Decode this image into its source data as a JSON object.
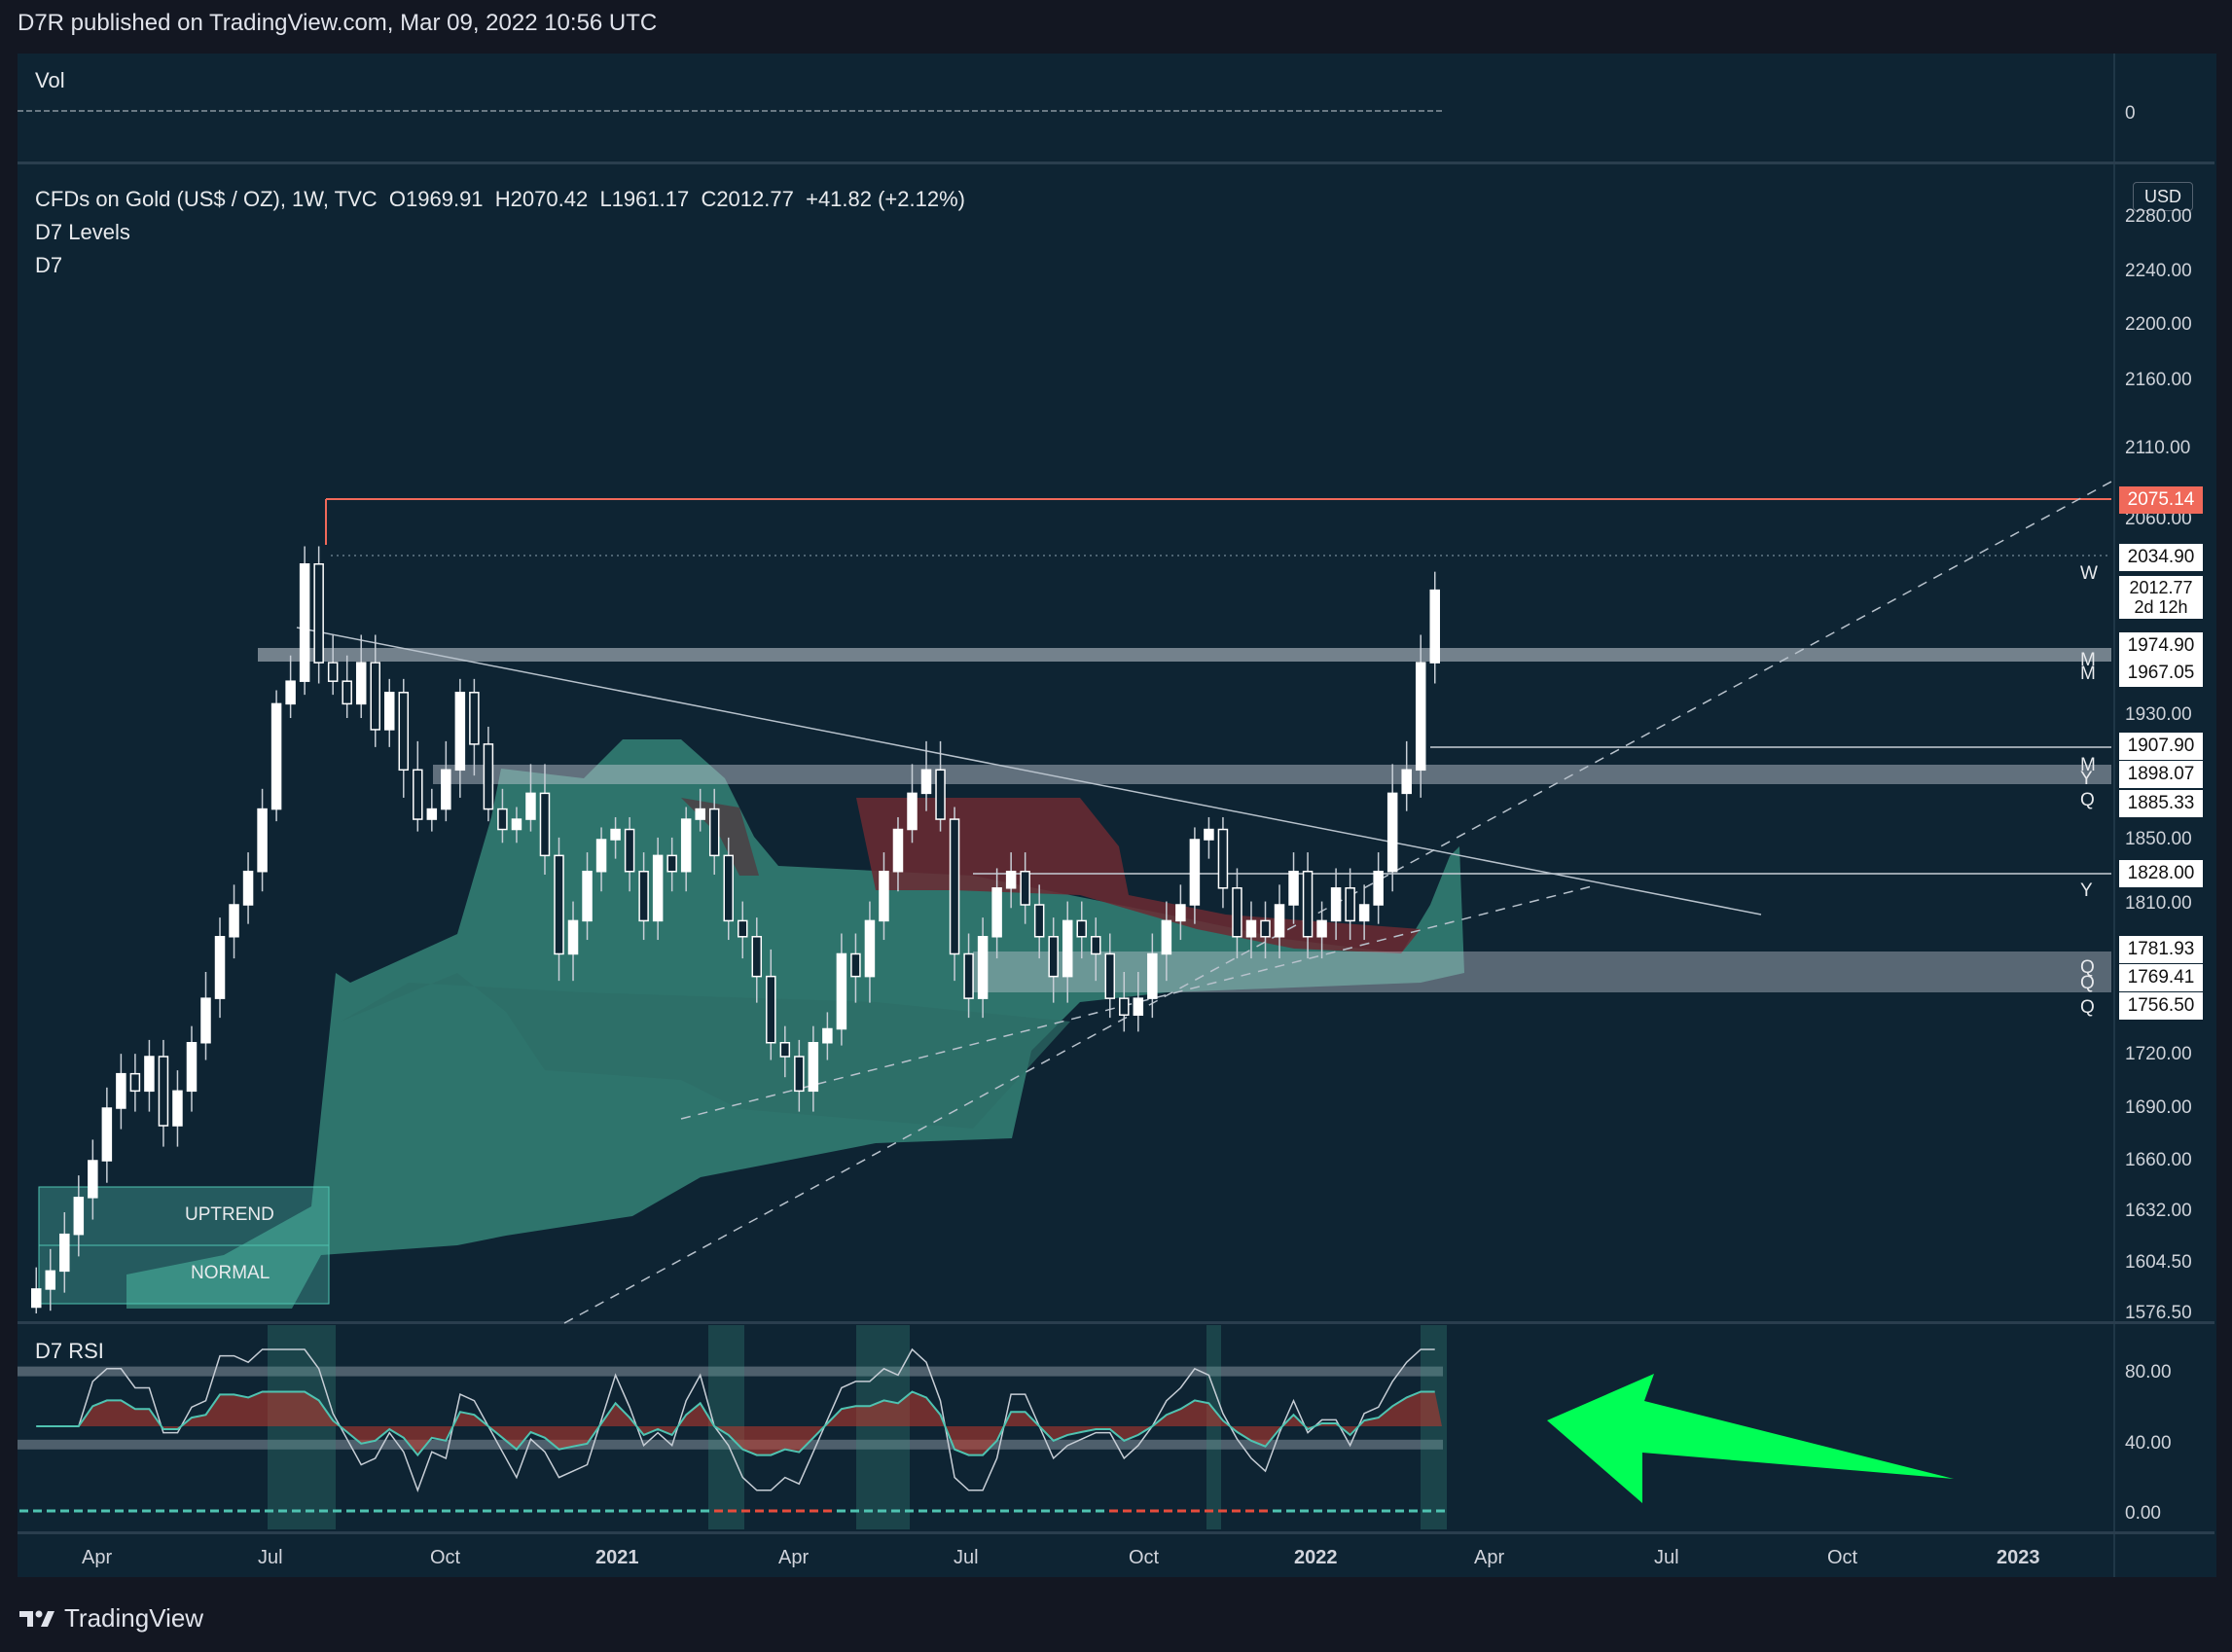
{
  "header": {
    "publisher": "D7R published on TradingView.com, Mar 09, 2022 10:56 UTC"
  },
  "volume_pane": {
    "title": "Vol",
    "axis_value": "0"
  },
  "main_pane": {
    "title": "CFDs on Gold (US$ / OZ), 1W, TVC",
    "ohlc": {
      "open": "O1969.91",
      "high": "H2070.42",
      "low": "L1961.17",
      "close": "C2012.77",
      "change": "+41.82 (+2.12%)"
    },
    "indicators": [
      "D7 Levels",
      "D7"
    ],
    "currency": "USD",
    "box_labels": {
      "upper": "UPTREND",
      "lower": "NORMAL"
    }
  },
  "rsi_pane": {
    "title": "D7 RSI",
    "ticks": [
      "80.00",
      "40.00",
      "0.00"
    ]
  },
  "price_axis": {
    "ticks": [
      "2280.00",
      "2240.00",
      "2200.00",
      "2160.00",
      "2110.00",
      "2060.00",
      "1930.00",
      "1850.00",
      "1810.00",
      "1720.00",
      "1690.00",
      "1660.00",
      "1632.00",
      "1604.50",
      "1576.50"
    ],
    "tags": [
      {
        "value": "2075.14",
        "style": "red"
      },
      {
        "value": "2034.90",
        "style": "white"
      },
      {
        "value": "2012.77",
        "sub": "2d 12h",
        "style": "white"
      },
      {
        "value": "1974.90",
        "style": "white"
      },
      {
        "value": "1967.05",
        "style": "white"
      },
      {
        "value": "1907.90",
        "style": "white"
      },
      {
        "value": "1898.07",
        "style": "white"
      },
      {
        "value": "1885.33",
        "style": "white"
      },
      {
        "value": "1828.00",
        "style": "white"
      },
      {
        "value": "1781.93",
        "style": "white"
      },
      {
        "value": "1769.41",
        "style": "white"
      },
      {
        "value": "1756.50",
        "style": "white"
      }
    ],
    "level_letters": [
      "W",
      "M",
      "M",
      "M",
      "Y",
      "Q",
      "Y",
      "Q",
      "Q",
      "Q"
    ]
  },
  "time_axis": {
    "labels": [
      "Apr",
      "Jul",
      "Oct",
      "2021",
      "Apr",
      "Jul",
      "Oct",
      "2022",
      "Apr",
      "Jul",
      "Oct",
      "2023"
    ],
    "bold": [
      "2021",
      "2022",
      "2023"
    ]
  },
  "footer": {
    "brand": "TradingView"
  },
  "colors": {
    "accent_red": "#f0695a",
    "teal": "#4fc3b1",
    "arrow_green": "#00ff55",
    "background": "#0e2433"
  },
  "chart_data": {
    "type": "candlestick",
    "price_range": [
      1576.5,
      2280
    ],
    "levels": [
      2075.14,
      2034.9,
      1974.9,
      1967.05,
      1907.9,
      1898.07,
      1885.33,
      1828.0,
      1781.93,
      1769.41,
      1756.5
    ],
    "closes": [
      1590,
      1600,
      1620,
      1640,
      1660,
      1690,
      1710,
      1700,
      1720,
      1680,
      1700,
      1730,
      1760,
      1790,
      1810,
      1830,
      1880,
      1940,
      1960,
      2030,
      1970,
      1960,
      1940,
      1970,
      1920,
      1950,
      1900,
      1870,
      1880,
      1900,
      1950,
      1910,
      1880,
      1860,
      1870,
      1890,
      1840,
      1780,
      1800,
      1830,
      1850,
      1860,
      1830,
      1800,
      1840,
      1830,
      1870,
      1880,
      1840,
      1800,
      1790,
      1770,
      1730,
      1720,
      1700,
      1730,
      1740,
      1780,
      1770,
      1800,
      1830,
      1860,
      1890,
      1900,
      1870,
      1780,
      1760,
      1790,
      1820,
      1830,
      1810,
      1790,
      1770,
      1800,
      1790,
      1780,
      1760,
      1750,
      1760,
      1780,
      1800,
      1810,
      1850,
      1860,
      1820,
      1790,
      1800,
      1790,
      1810,
      1830,
      1790,
      1800,
      1820,
      1800,
      1810,
      1830,
      1890,
      1900,
      1970,
      2013
    ],
    "rsi_range": [
      0,
      100
    ],
    "rsi_levels": [
      80,
      40
    ]
  }
}
